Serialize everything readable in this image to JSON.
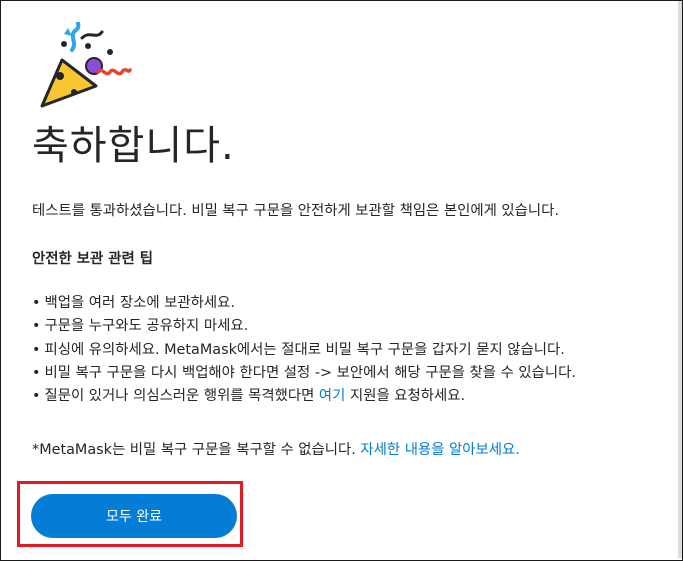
{
  "header": {
    "title": "축하합니다."
  },
  "intro": "테스트를 통과하셨습니다. 비밀 복구 구문을 안전하게 보관할 책임은 본인에게 있습니다.",
  "tips": {
    "heading": "안전한 보관 관련 팁",
    "bullet": "•",
    "items": [
      {
        "text": "백업을 여러 장소에 보관하세요."
      },
      {
        "text": "구문을 누구와도 공유하지 마세요."
      },
      {
        "text": "피싱에 유의하세요. MetaMask에서는 절대로 비밀 복구 구문을 갑자기 묻지 않습니다."
      },
      {
        "text": "비밀 복구 구문을 다시 백업해야 한다면 설정 -> 보안에서 해당 구문을 찾을 수 있습니다."
      },
      {
        "before": "질문이 있거나 의심스러운 행위를 목격했다면 ",
        "link": "여기",
        "after": " 지원을 요청하세요."
      }
    ]
  },
  "note": {
    "text": "*MetaMask는 비밀 복구 구문을 복구할 수 없습니다. ",
    "link": "자세한 내용을 알아보세요."
  },
  "actions": {
    "all_done": "모두 완료"
  },
  "colors": {
    "accent": "#037dd6",
    "highlight": "#e51b24",
    "text": "#24272a"
  },
  "icons": {
    "hero": "party-popper-icon"
  }
}
